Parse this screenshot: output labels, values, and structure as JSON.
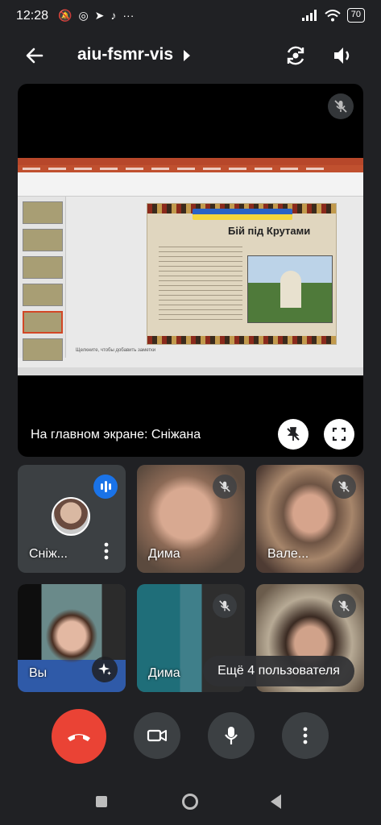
{
  "status_bar": {
    "time": "12:28",
    "battery": "70",
    "icons": [
      "mute-icon",
      "chrome-icon",
      "telegram-icon",
      "tiktok-icon",
      "more-icon",
      "signal-icon",
      "wifi-icon",
      "battery-icon"
    ]
  },
  "header": {
    "title": "aiu-fsmr-vis"
  },
  "main_stage": {
    "label": "На главном экране: Сніжана",
    "slide": {
      "title": "Бій під Крутами",
      "notes_placeholder": "Щелкните, чтобы добавить заметки"
    }
  },
  "participants": [
    {
      "name": "Сніж...",
      "mic": "speaking",
      "avatar": true
    },
    {
      "name": "Дима",
      "mic": "off"
    },
    {
      "name": "Вале...",
      "mic": "off"
    },
    {
      "name": "Вы",
      "mic": "on"
    },
    {
      "name": "Дима",
      "mic": "off"
    },
    {
      "name": "",
      "mic": "off"
    }
  ],
  "more_users": "Ещё 4 пользователя",
  "controls": [
    "end-call",
    "camera",
    "microphone",
    "more-options"
  ],
  "colors": {
    "background": "#202124",
    "end_call": "#ea4335",
    "speaking": "#1a73e8",
    "control_bg": "#3c4043"
  }
}
